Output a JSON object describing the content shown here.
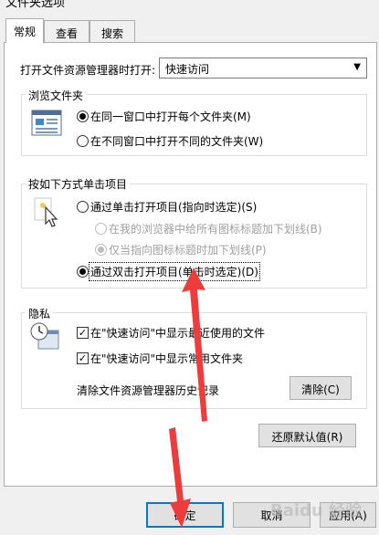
{
  "window": {
    "title": "文件夹选项"
  },
  "tabs": [
    {
      "label": "常规",
      "active": true
    },
    {
      "label": "查看",
      "active": false
    },
    {
      "label": "搜索",
      "active": false
    }
  ],
  "open_explorer": {
    "label": "打开文件资源管理器时打开:",
    "value": "快速访问"
  },
  "browse": {
    "title": "浏览文件夹",
    "option_same": "在同一窗口中打开每个文件夹(M)",
    "option_new": "在不同窗口中打开不同的文件夹(W)",
    "selected": "same"
  },
  "click": {
    "title": "按如下方式单击项目",
    "single": "通过单击打开项目(指向时选定)(S)",
    "underline_all": "在我的浏览器中给所有图标标题加下划线(B)",
    "underline_hover": "仅当指向图标标题时加下划线(P)",
    "double": "通过双击打开项目(单击时选定)(D)",
    "selected": "double"
  },
  "privacy": {
    "title": "隐私",
    "recent_files": "在\"快速访问\"中显示最近使用的文件",
    "frequent_folders": "在\"快速访问\"中显示常用文件夹",
    "clear_label": "清除文件资源管理器历史记录",
    "clear_button": "清除(C)",
    "recent_checked": true,
    "frequent_checked": true
  },
  "restore_button": "还原默认值(R)",
  "footer": {
    "ok": "确定",
    "cancel": "取消",
    "apply": "应用(A)"
  },
  "watermark": "Baidu 经验",
  "colors": {
    "accent": "#0078d7",
    "annotation_arrow": "#ee3b3b"
  }
}
